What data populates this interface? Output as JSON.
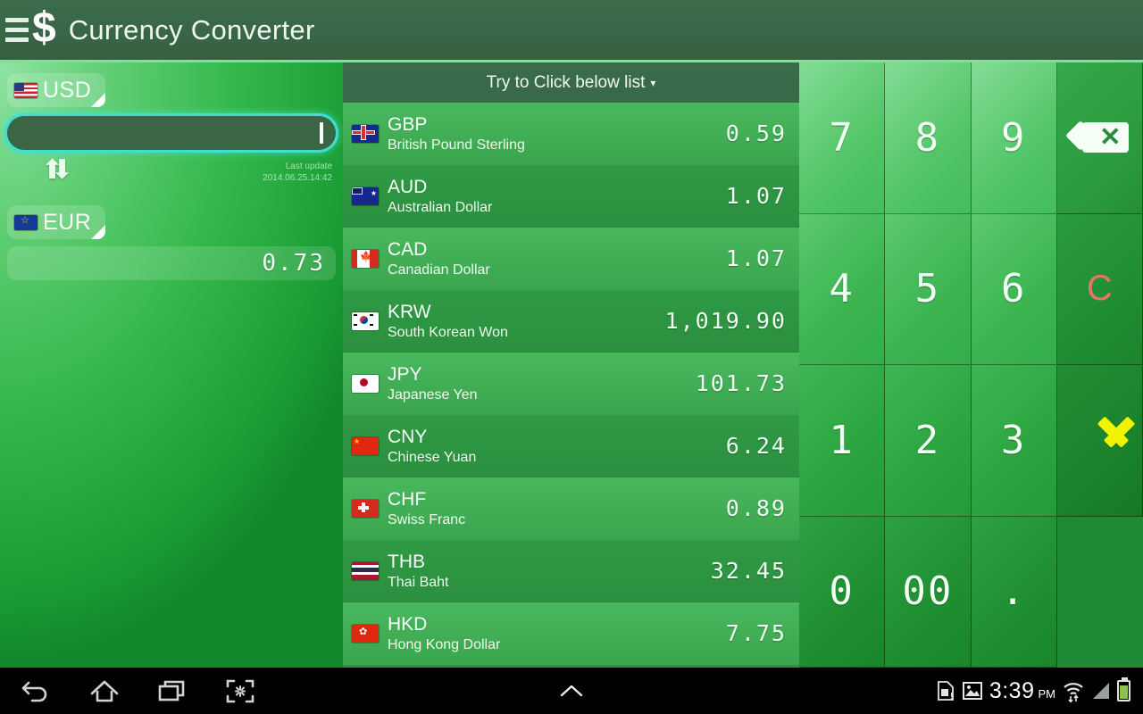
{
  "titlebar": {
    "menu_icon": "hamburger-icon",
    "logo_icon": "dollar-icon",
    "logo_glyph": "$",
    "title": "Currency Converter"
  },
  "converter": {
    "from": {
      "code": "USD",
      "flag": "flag-us"
    },
    "to": {
      "code": "EUR",
      "flag": "flag-eu"
    },
    "amount_value": "",
    "amount_placeholder": "",
    "swap_icon": "swap-arrows-icon",
    "last_update_label": "Last update",
    "last_update_value": "2014.06.25.14:42",
    "result_value": "0.73"
  },
  "list": {
    "header": "Try to Click below list",
    "header_caret": "▾",
    "rows": [
      {
        "code": "GBP",
        "name": "British Pound Sterling",
        "rate": "0.59",
        "flag": "flag-gb"
      },
      {
        "code": "AUD",
        "name": "Australian Dollar",
        "rate": "1.07",
        "flag": "flag-au"
      },
      {
        "code": "CAD",
        "name": "Canadian Dollar",
        "rate": "1.07",
        "flag": "flag-ca"
      },
      {
        "code": "KRW",
        "name": "South Korean Won",
        "rate": "1,019.90",
        "flag": "flag-kr"
      },
      {
        "code": "JPY",
        "name": "Japanese Yen",
        "rate": "101.73",
        "flag": "flag-jp"
      },
      {
        "code": "CNY",
        "name": "Chinese Yuan",
        "rate": "6.24",
        "flag": "flag-cn"
      },
      {
        "code": "CHF",
        "name": "Swiss Franc",
        "rate": "0.89",
        "flag": "flag-ch"
      },
      {
        "code": "THB",
        "name": "Thai Baht",
        "rate": "32.45",
        "flag": "flag-th"
      },
      {
        "code": "HKD",
        "name": "Hong Kong Dollar",
        "rate": "7.75",
        "flag": "flag-hk"
      }
    ]
  },
  "keypad": {
    "keys": [
      {
        "label": "7",
        "name": "key-7"
      },
      {
        "label": "8",
        "name": "key-8"
      },
      {
        "label": "9",
        "name": "key-9"
      },
      {
        "label": "",
        "name": "key-backspace",
        "icon": "backspace-icon"
      },
      {
        "label": "4",
        "name": "key-4"
      },
      {
        "label": "5",
        "name": "key-5"
      },
      {
        "label": "6",
        "name": "key-6"
      },
      {
        "label": "C",
        "name": "key-clear"
      },
      {
        "label": "1",
        "name": "key-1"
      },
      {
        "label": "2",
        "name": "key-2"
      },
      {
        "label": "3",
        "name": "key-3"
      },
      {
        "label": "",
        "name": "key-hide-keyboard",
        "icon": "chevron-down-icon"
      },
      {
        "label": "0",
        "name": "key-0"
      },
      {
        "label": "00",
        "name": "key-double-zero"
      },
      {
        "label": ".",
        "name": "key-decimal-point"
      }
    ],
    "clear_color": "#e8736a",
    "hide_color": "#f2f205"
  },
  "systembar": {
    "back_icon": "back-icon",
    "home_icon": "home-icon",
    "recents_icon": "recents-icon",
    "screenshot_icon": "screenshot-icon",
    "expand_icon": "chevron-up-icon",
    "sdcard_icon": "sdcard-warning-icon",
    "gallery_icon": "image-icon",
    "time": "3:39",
    "ampm": "PM",
    "wifi_icon": "wifi-icon",
    "signal_icon": "signal-icon",
    "battery_icon": "battery-icon"
  }
}
